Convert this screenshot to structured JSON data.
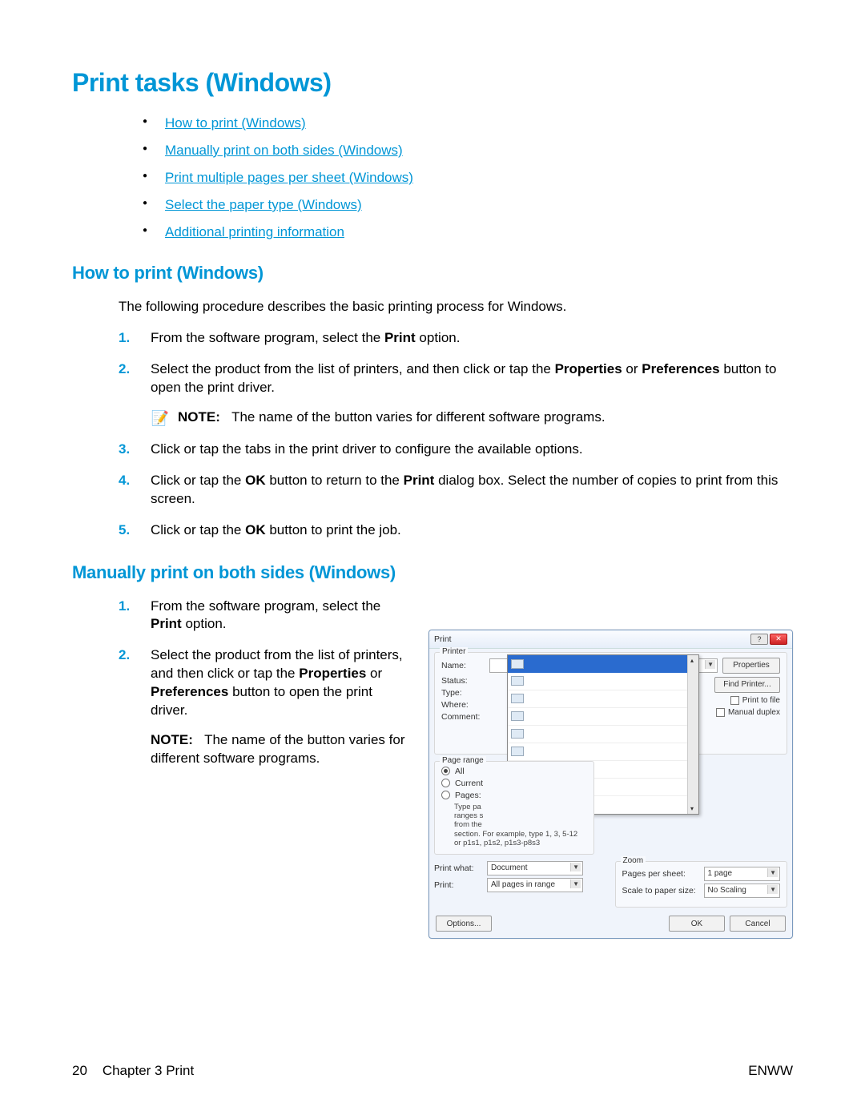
{
  "h1": "Print tasks (Windows)",
  "toc": [
    "How to print (Windows)",
    "Manually print on both sides (Windows)",
    "Print multiple pages per sheet (Windows)",
    "Select the paper type (Windows)",
    "Additional printing information"
  ],
  "s1": {
    "title": "How to print (Windows)",
    "intro": "The following procedure describes the basic printing process for Windows.",
    "step1_a": "From the software program, select the ",
    "step1_b": "Print",
    "step1_c": " option.",
    "step2_a": "Select the product from the list of printers, and then click or tap the ",
    "step2_b": "Properties",
    "step2_c": " or ",
    "step2_d": "Preferences",
    "step2_e": " button to open the print driver.",
    "note_label": "NOTE:",
    "note_text": "The name of the button varies for different software programs.",
    "step3": "Click or tap the tabs in the print driver to configure the available options.",
    "step4_a": "Click or tap the ",
    "step4_b": "OK",
    "step4_c": " button to return to the ",
    "step4_d": "Print",
    "step4_e": " dialog box. Select the number of copies to print from this screen.",
    "step5_a": "Click or tap the ",
    "step5_b": "OK",
    "step5_c": " button to print the job."
  },
  "s2": {
    "title": "Manually print on both sides (Windows)",
    "step1_a": "From the software program, select the ",
    "step1_b": "Print",
    "step1_c": " option.",
    "step2_a": "Select the product from the list of printers, and then click or tap the ",
    "step2_b": "Properties",
    "step2_c": " or ",
    "step2_d": "Preferences",
    "step2_e": " button to open the print driver.",
    "note_label": "NOTE:",
    "note_text": "The name of the button varies for different software programs."
  },
  "dlg": {
    "title": "Print",
    "printer": "Printer",
    "name": "Name:",
    "status": "Status:",
    "type": "Type:",
    "where": "Where:",
    "comment": "Comment:",
    "properties": "Properties",
    "find_printer": "Find Printer...",
    "print_to_file": "Print to file",
    "manual_duplex": "Manual duplex",
    "page_range": "Page range",
    "all": "All",
    "current": "Current",
    "pages": "Pages:",
    "type_pages_a": "Type pa",
    "type_pages_b": "ranges s",
    "type_pages_c": "from the",
    "type_pages_d": "section. For example, type 1, 3, 5-12",
    "type_pages_e": "or p1s1, p1s2, p1s3-p8s3",
    "print_what": "Print what:",
    "print_what_v": "Document",
    "print": "Print:",
    "print_v": "All pages in range",
    "zoom": "Zoom",
    "pps": "Pages per sheet:",
    "pps_v": "1 page",
    "scale": "Scale to paper size:",
    "scale_v": "No Scaling",
    "options": "Options...",
    "ok": "OK",
    "cancel": "Cancel"
  },
  "footer": {
    "page": "20",
    "chapter": "Chapter 3   Print",
    "right": "ENWW"
  }
}
